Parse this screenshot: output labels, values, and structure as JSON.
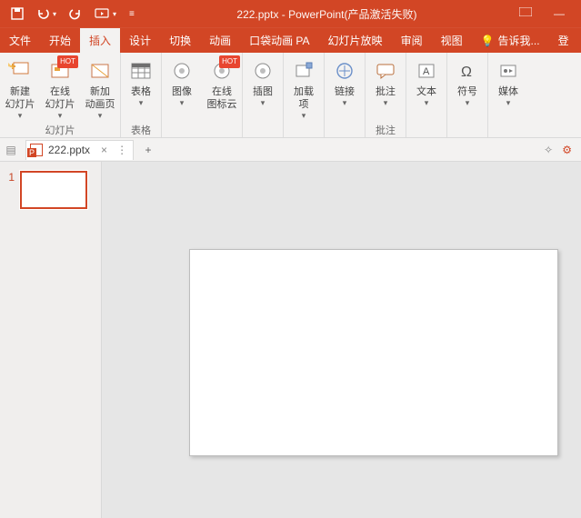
{
  "app": {
    "title": "222.pptx - PowerPoint(产品激活失败)"
  },
  "qat": {
    "save": "save-icon",
    "undo": "undo-icon",
    "redo": "redo-icon",
    "start": "start-from-beginning",
    "more": "▾"
  },
  "winbtns": {
    "min": "—",
    "max": "▭"
  },
  "tabs": {
    "file": "文件",
    "home": "开始",
    "insert": "插入",
    "design": "设计",
    "transitions": "切换",
    "animations": "动画",
    "pocket": "口袋动画 PA",
    "slideshow": "幻灯片放映",
    "review": "审阅",
    "view": "视图",
    "tell": "告诉我...",
    "signin": "登"
  },
  "ribbon": {
    "groups": {
      "slides": {
        "label": "幻灯片",
        "new_slide": "新建\n幻灯片",
        "online_slide": "在线\n幻灯片",
        "new_anim": "新加\n动画页",
        "hot": "HOT"
      },
      "tables": {
        "label": "表格",
        "btn": "表格"
      },
      "images": {
        "label": "",
        "img": "图像",
        "iconcloud": "在线\n图标云",
        "hot": "HOT"
      },
      "illus": {
        "label": "",
        "btn": "插图"
      },
      "addins": {
        "label": "",
        "btn": "加载\n项"
      },
      "links": {
        "label": "",
        "btn": "链接"
      },
      "comments": {
        "label": "批注",
        "btn": "批注"
      },
      "text": {
        "label": "",
        "btn": "文本"
      },
      "symbols": {
        "label": "",
        "btn": "符号"
      },
      "media": {
        "label": "",
        "btn": "媒体"
      }
    }
  },
  "doc": {
    "filename": "222.pptx",
    "close": "×",
    "add": "+",
    "more": "⋮"
  },
  "thumbs": {
    "n1": "1"
  }
}
